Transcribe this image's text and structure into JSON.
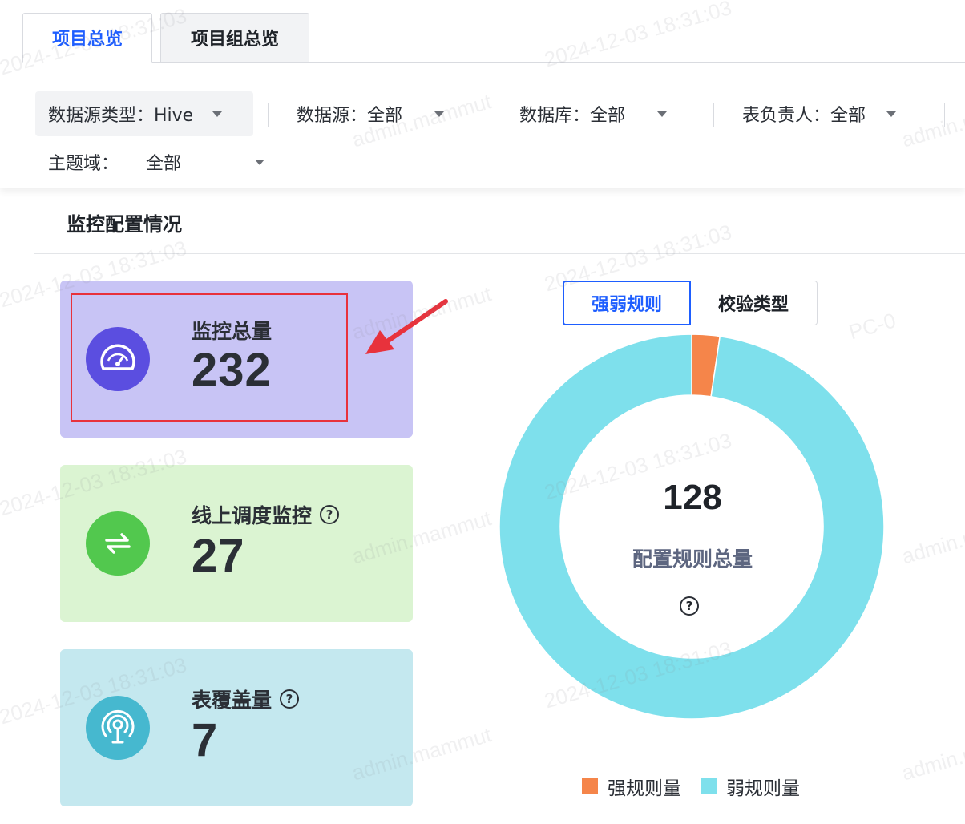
{
  "tabs": [
    {
      "label": "项目总览",
      "active": true
    },
    {
      "label": "项目组总览",
      "active": false
    }
  ],
  "filters": {
    "source_type": "数据源类型：Hive",
    "source": "数据源：全部",
    "database": "数据库：全部",
    "owner": "表负责人：全部",
    "subject_label": "主题域：",
    "subject_value": "全部"
  },
  "panel": {
    "title": "监控配置情况"
  },
  "cards": {
    "total": {
      "label": "监控总量",
      "value": "232",
      "icon": "gauge-icon",
      "bg": "#c8c4f5",
      "icon_bg": "#5b4ee0"
    },
    "online": {
      "label": "线上调度监控",
      "value": "27",
      "icon": "swap-arrows-icon",
      "bg": "#dbf4d2",
      "icon_bg": "#52c84e"
    },
    "coverage": {
      "label": "表覆盖量",
      "value": "7",
      "icon": "broadcast-icon",
      "bg": "#c4e8ef",
      "icon_bg": "#46b8cf"
    }
  },
  "help_glyph": "?",
  "segments": {
    "strong_weak": "强弱规则",
    "check_type": "校验类型"
  },
  "chart_data": {
    "type": "pie",
    "donut": true,
    "center_value": "128",
    "center_label": "配置规则总量",
    "series": [
      {
        "name": "强规则量",
        "value": 3,
        "color": "#f5854a"
      },
      {
        "name": "弱规则量",
        "value": 125,
        "color": "#7ee0ec"
      }
    ],
    "legend_position": "bottom"
  },
  "watermark": {
    "timestamp": "2024-12-03 18:31:03",
    "user": "admin.mammut",
    "host": "PC-0"
  }
}
